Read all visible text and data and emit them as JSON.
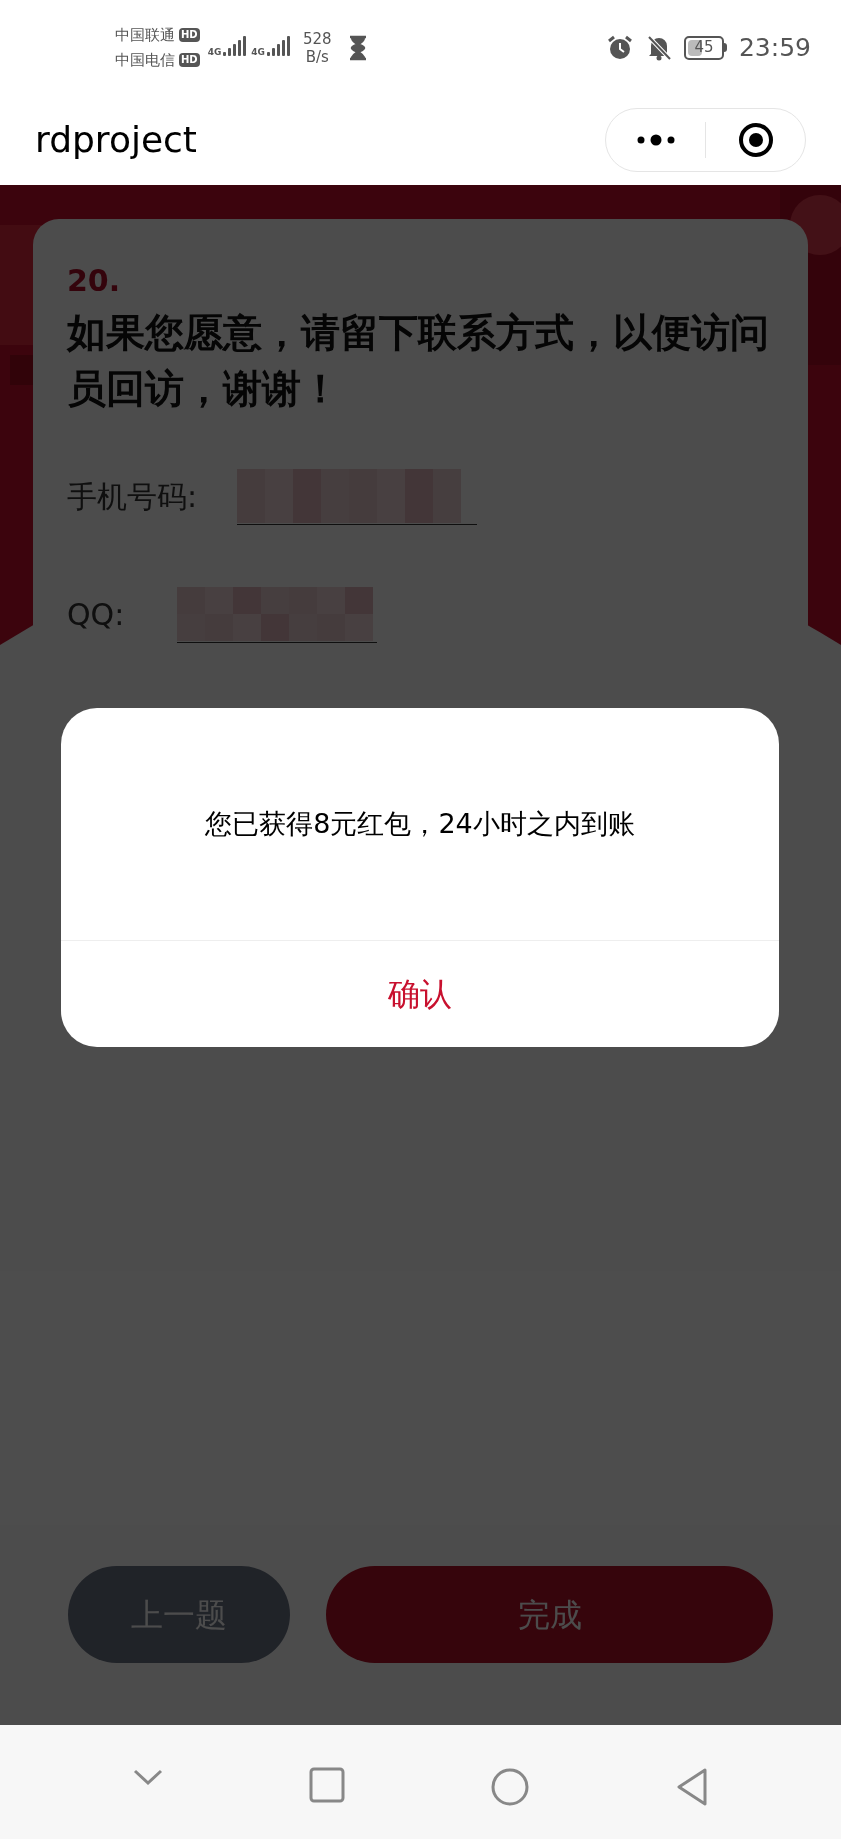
{
  "status_bar": {
    "carriers": [
      {
        "name": "中国联通",
        "badge": "HD",
        "network": "4G"
      },
      {
        "name": "中国电信",
        "badge": "HD",
        "network": "4G"
      }
    ],
    "speed": "528",
    "speed_unit": "B/s",
    "battery": "45",
    "time": "23:59"
  },
  "title_bar": {
    "title": "rdproject"
  },
  "question": {
    "number": "20.",
    "text": "如果您愿意，请留下联系方式，以便访问员回访，谢谢！"
  },
  "fields": [
    {
      "label": "手机号码:",
      "redacted": true
    },
    {
      "label": "QQ:",
      "redacted": true
    }
  ],
  "buttons": [
    {
      "label": "上一题",
      "kind": "secondary"
    },
    {
      "label": "完成",
      "kind": "primary"
    }
  ],
  "dialog": {
    "message": "您已获得8元红包，24小时之内到账",
    "confirm": "确认"
  }
}
